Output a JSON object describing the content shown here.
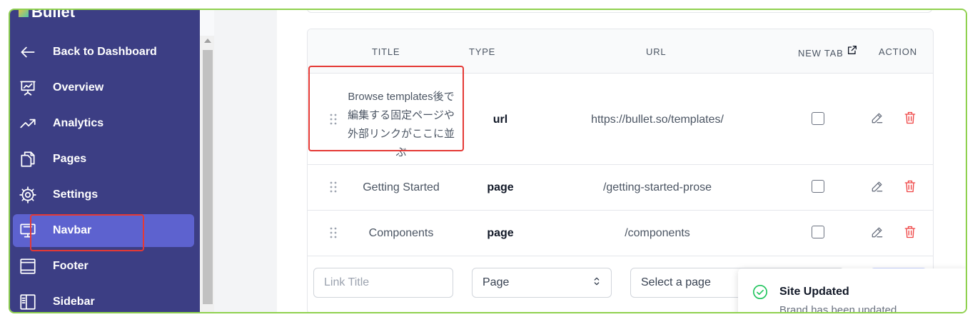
{
  "app": {
    "logo_text": "Bullet"
  },
  "sidebar": {
    "items": [
      {
        "label": "Back to Dashboard",
        "icon": "arrow-left-icon"
      },
      {
        "label": "Overview",
        "icon": "presentation-chart-icon"
      },
      {
        "label": "Analytics",
        "icon": "trending-up-icon"
      },
      {
        "label": "Pages",
        "icon": "pages-icon"
      },
      {
        "label": "Settings",
        "icon": "gear-icon"
      },
      {
        "label": "Navbar",
        "icon": "desktop-icon",
        "active": true
      },
      {
        "label": "Footer",
        "icon": "footer-layout-icon"
      },
      {
        "label": "Sidebar",
        "icon": "sidebar-layout-icon"
      }
    ]
  },
  "table": {
    "headers": {
      "title": "TITLE",
      "type": "TYPE",
      "url": "URL",
      "new_tab": "NEW TAB",
      "action": "ACTION"
    },
    "rows": [
      {
        "title": "Browse templates後で編集する固定ページや外部リンクがここに並ぶ",
        "type": "url",
        "url": "https://bullet.so/templates/",
        "new_tab": false
      },
      {
        "title": "Getting Started",
        "type": "page",
        "url": "/getting-started-prose",
        "new_tab": false
      },
      {
        "title": "Components",
        "type": "page",
        "url": "/components",
        "new_tab": false
      }
    ]
  },
  "form": {
    "link_title_placeholder": "Link Title",
    "type_value": "Page",
    "page_select_placeholder": "Select a page"
  },
  "toast": {
    "title": "Site Updated",
    "message": "Brand has been updated",
    "icon": "check-circle-icon",
    "color": "#22c55e"
  },
  "colors": {
    "sidebar_bg": "#3c3e84",
    "active_item": "#5d62cf",
    "delete": "#ef4444",
    "frame_border": "#8fd14f"
  }
}
